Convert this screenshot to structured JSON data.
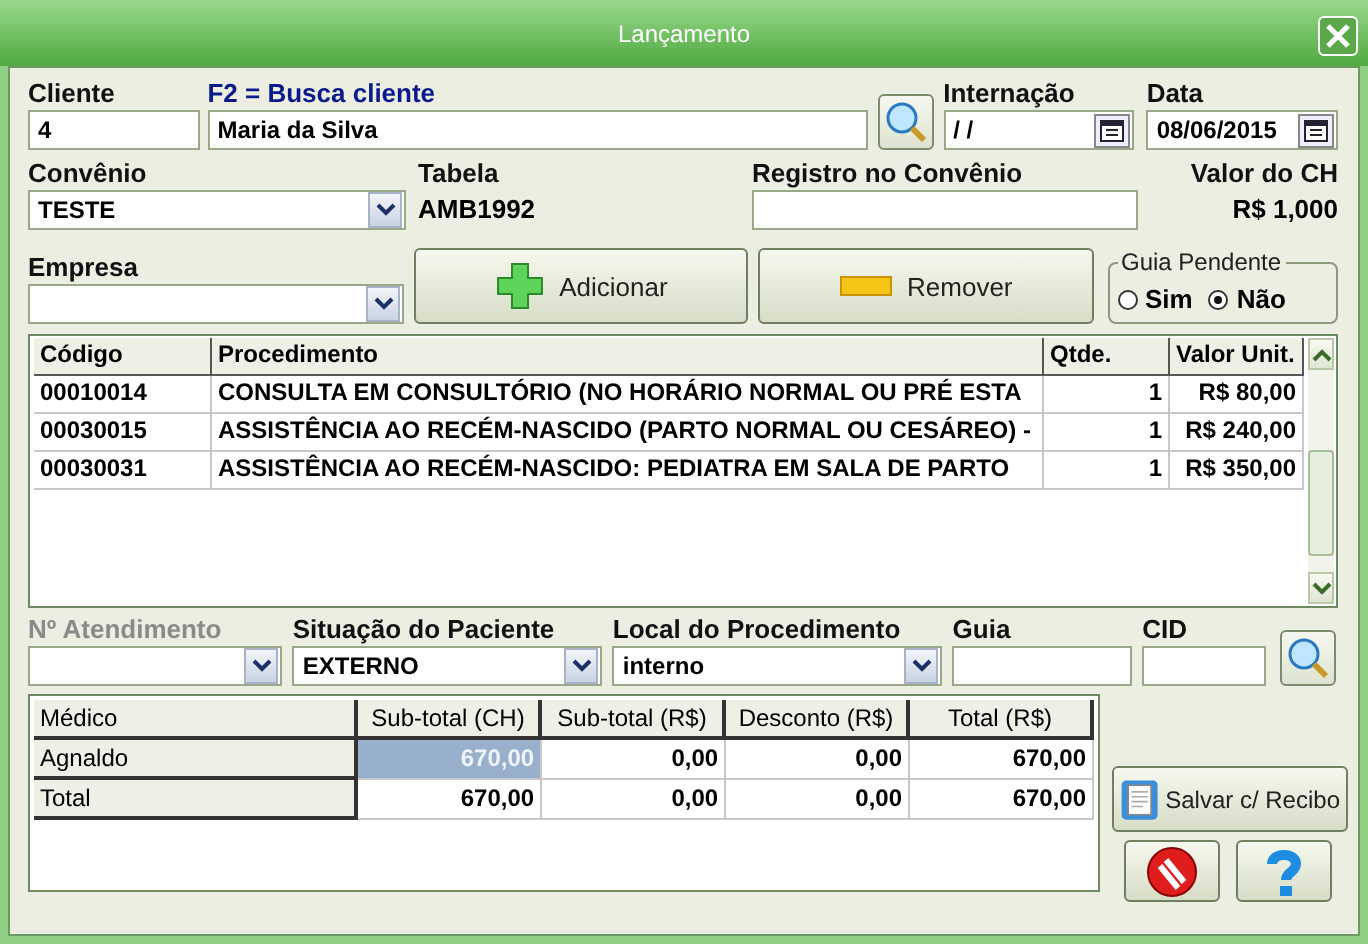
{
  "window": {
    "title": "Lançamento"
  },
  "cliente": {
    "label": "Cliente",
    "code": "4"
  },
  "busca": {
    "label": "F2 = Busca cliente",
    "name": "Maria da Silva"
  },
  "internacao": {
    "label": "Internação",
    "value": "/ /"
  },
  "data": {
    "label": "Data",
    "value": "08/06/2015"
  },
  "convenio": {
    "label": "Convênio",
    "value": "TESTE"
  },
  "tabela": {
    "label": "Tabela",
    "value": "AMB1992"
  },
  "registro": {
    "label": "Registro no Convênio"
  },
  "valor_ch": {
    "label": "Valor do CH",
    "value": "R$ 1,000"
  },
  "empresa": {
    "label": "Empresa"
  },
  "actions": [
    {
      "kind": "add",
      "label": "Adicionar"
    },
    {
      "kind": "remove",
      "label": "Remover"
    }
  ],
  "guia_pendente": {
    "title": "Guia Pendente",
    "options": [
      {
        "label": "Sim",
        "selected": false
      },
      {
        "label": "Não",
        "selected": true
      }
    ]
  },
  "procedures": {
    "columns": [
      "Código",
      "Procedimento",
      "Qtde.",
      "Valor Unit."
    ],
    "rows": [
      [
        "00010014",
        "CONSULTA EM CONSULTÓRIO (NO HORÁRIO NORMAL OU PRÉ ESTA",
        "1",
        "R$ 80,00"
      ],
      [
        "00030015",
        "ASSISTÊNCIA AO RECÉM-NASCIDO (PARTO NORMAL OU CESÁREO) -",
        "1",
        "R$ 240,00"
      ],
      [
        "00030031",
        "ASSISTÊNCIA AO RECÉM-NASCIDO: PEDIATRA EM SALA DE PARTO",
        "1",
        "R$ 350,00"
      ]
    ]
  },
  "fields": [
    {
      "kind": "combo",
      "label": "Nº Atendimento",
      "disabled": true
    },
    {
      "kind": "combo",
      "label": "Situação do Paciente",
      "value": "EXTERNO",
      "disabled": false
    },
    {
      "kind": "combo",
      "label": "Local do Procedimento",
      "value": "interno",
      "disabled": false
    },
    {
      "kind": "text",
      "label": "Guia",
      "disabled": false
    },
    {
      "kind": "text",
      "label": "CID",
      "disabled": false
    }
  ],
  "totals": {
    "columns": [
      "Médico",
      "Sub-total (CH)",
      "Sub-total (R$)",
      "Desconto (R$)",
      "Total (R$)"
    ],
    "rows": [
      {
        "cells": [
          {
            "text": "Agnaldo",
            "selected": false
          },
          {
            "text": "670,00",
            "selected": true
          },
          {
            "text": "0,00",
            "selected": false
          },
          {
            "text": "0,00",
            "selected": false
          },
          {
            "text": "670,00",
            "selected": false
          }
        ]
      },
      {
        "cells": [
          {
            "text": "Total",
            "selected": false
          },
          {
            "text": "670,00",
            "selected": false
          },
          {
            "text": "0,00",
            "selected": false
          },
          {
            "text": "0,00",
            "selected": false
          },
          {
            "text": "670,00",
            "selected": false
          }
        ]
      }
    ]
  },
  "save_button": "Salvar c/ Recibo"
}
